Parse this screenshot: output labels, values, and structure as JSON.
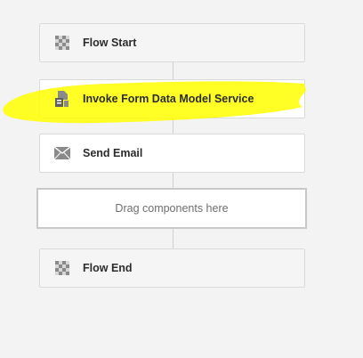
{
  "workflow": {
    "steps": [
      {
        "label": "Flow Start",
        "icon": "checkerboard-icon"
      },
      {
        "label": "Invoke Form Data Model Service",
        "icon": "form-data-model-icon"
      },
      {
        "label": "Send Email",
        "icon": "envelope-icon"
      },
      {
        "label": "Flow End",
        "icon": "checkerboard-icon"
      }
    ],
    "dropzone_label": "Drag components here"
  },
  "colors": {
    "highlight": "#ffff00",
    "card_border": "#dadada",
    "canvas_bg": "#f3f3f3",
    "icon": "#8a8a8a"
  }
}
